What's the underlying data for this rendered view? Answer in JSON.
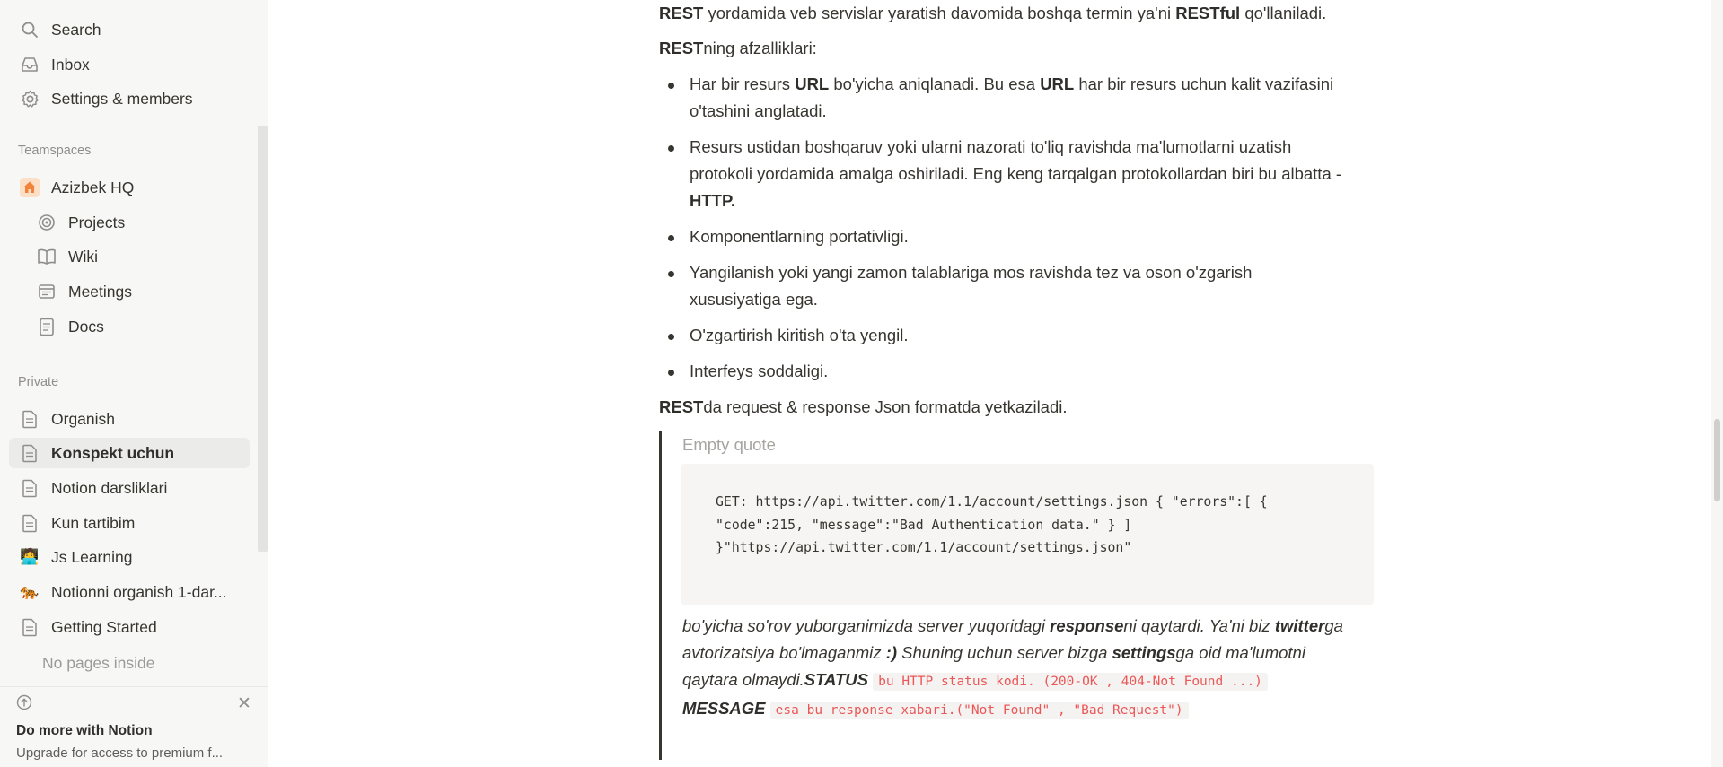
{
  "sidebar": {
    "top_items": [
      {
        "label": "Search",
        "icon": "search-icon"
      },
      {
        "label": "Inbox",
        "icon": "inbox-icon"
      },
      {
        "label": "Settings & members",
        "icon": "gear-icon"
      }
    ],
    "teamspaces_label": "Teamspaces",
    "teamspace": {
      "label": "Azizbek HQ",
      "icon": "home-icon",
      "icon_color": "#f7a15a"
    },
    "teamspace_items": [
      {
        "label": "Projects",
        "icon": "target-icon"
      },
      {
        "label": "Wiki",
        "icon": "book-icon"
      },
      {
        "label": "Meetings",
        "icon": "calendar-icon"
      },
      {
        "label": "Docs",
        "icon": "document-icon"
      }
    ],
    "private_label": "Private",
    "private_items": [
      {
        "label": "Organish",
        "icon": "page-icon"
      },
      {
        "label": "Konspekt uchun",
        "icon": "page-icon",
        "selected": true
      },
      {
        "label": "Notion darsliklari",
        "icon": "page-icon"
      },
      {
        "label": "Kun tartibim",
        "icon": "page-icon"
      },
      {
        "label": "Js Learning",
        "icon": "technologist-emoji-icon",
        "emoji": "🧑‍💻"
      },
      {
        "label": "Notionni organish 1-dar...",
        "icon": "tiger-emoji-icon",
        "emoji": "🐅"
      },
      {
        "label": "Getting Started",
        "icon": "page-icon"
      }
    ],
    "no_pages_label": "No pages inside",
    "promo": {
      "title": "Do more with Notion",
      "description": "Upgrade for access to premium f..."
    }
  },
  "content": {
    "top_cut_line": {
      "parts": [
        {
          "t": "REST",
          "b": true
        },
        {
          "t": " yordamida veb servislar yaratish davomida boshqa termin ya'ni ",
          "b": false
        },
        {
          "t": "RESTful",
          "b": true
        },
        {
          "t": " qo'llaniladi.",
          "b": false
        }
      ]
    },
    "advantages_heading": {
      "bold": "REST",
      "rest": "ning afzalliklari:"
    },
    "bullets": [
      [
        {
          "t": "Har bir resurs ",
          "b": false
        },
        {
          "t": "URL",
          "b": true
        },
        {
          "t": " bo'yicha aniqlanadi. Bu esa ",
          "b": false
        },
        {
          "t": "URL",
          "b": true
        },
        {
          "t": " har bir resurs uchun kalit vazifasini o'tashini anglatadi.",
          "b": false
        }
      ],
      [
        {
          "t": "Resurs ustidan boshqaruv yoki ularni nazorati to'liq ravishda ma'lumotlarni uzatish protokoli yordamida amalga oshiriladi. Eng keng tarqalgan protokollardan biri bu albatta - ",
          "b": false
        },
        {
          "t": "HTTP.",
          "b": true
        }
      ],
      [
        {
          "t": "Komponentlarning portativligi.",
          "b": false
        }
      ],
      [
        {
          "t": "Yangilanish yoki yangi zamon talablariga mos ravishda tez va oson o'zgarish xususiyatiga ega.",
          "b": false
        }
      ],
      [
        {
          "t": "O'zgartirish kiritish o'ta yengil.",
          "b": false
        }
      ],
      [
        {
          "t": "Interfeys soddaligi.",
          "b": false
        }
      ]
    ],
    "json_line": {
      "bold": "REST",
      "rest": "da request & response Json formatda yetkaziladi."
    },
    "quote": {
      "placeholder": "Empty quote",
      "code": "GET: https://api.twitter.com/1.1/account/settings.json { \"errors\":[ { \"code\":215, \"message\":\"Bad Authentication data.\" } ] }\"https://api.twitter.com/1.1/account/settings.json\"",
      "text_parts": [
        {
          "t": "bo'yicha so'rov yuborganimizda server yuqoridagi ",
          "k": "n"
        },
        {
          "t": "response",
          "k": "b"
        },
        {
          "t": "ni qaytardi. Ya'ni biz ",
          "k": "n"
        },
        {
          "t": "twitter",
          "k": "b"
        },
        {
          "t": "ga avtorizatsiya bo'lmaganmiz ",
          "k": "n"
        },
        {
          "t": ":)",
          "k": "b"
        },
        {
          "t": " Shuning uchun server bizga ",
          "k": "n"
        },
        {
          "t": "settings",
          "k": "b"
        },
        {
          "t": "ga oid ma'lumotni qaytara olmaydi.",
          "k": "n"
        },
        {
          "t": "STATUS",
          "k": "b"
        },
        {
          "t": " ",
          "k": "n"
        },
        {
          "t": "bu HTTP status kodi. (200-OK , 404-Not Found ...)",
          "k": "c"
        },
        {
          "t": " ",
          "k": "n"
        },
        {
          "t": "MESSAGE",
          "k": "b"
        },
        {
          "t": " ",
          "k": "n"
        },
        {
          "t": "esa bu response xabari.(\"Not Found\" , \"Bad Request\")",
          "k": "c"
        }
      ]
    }
  }
}
